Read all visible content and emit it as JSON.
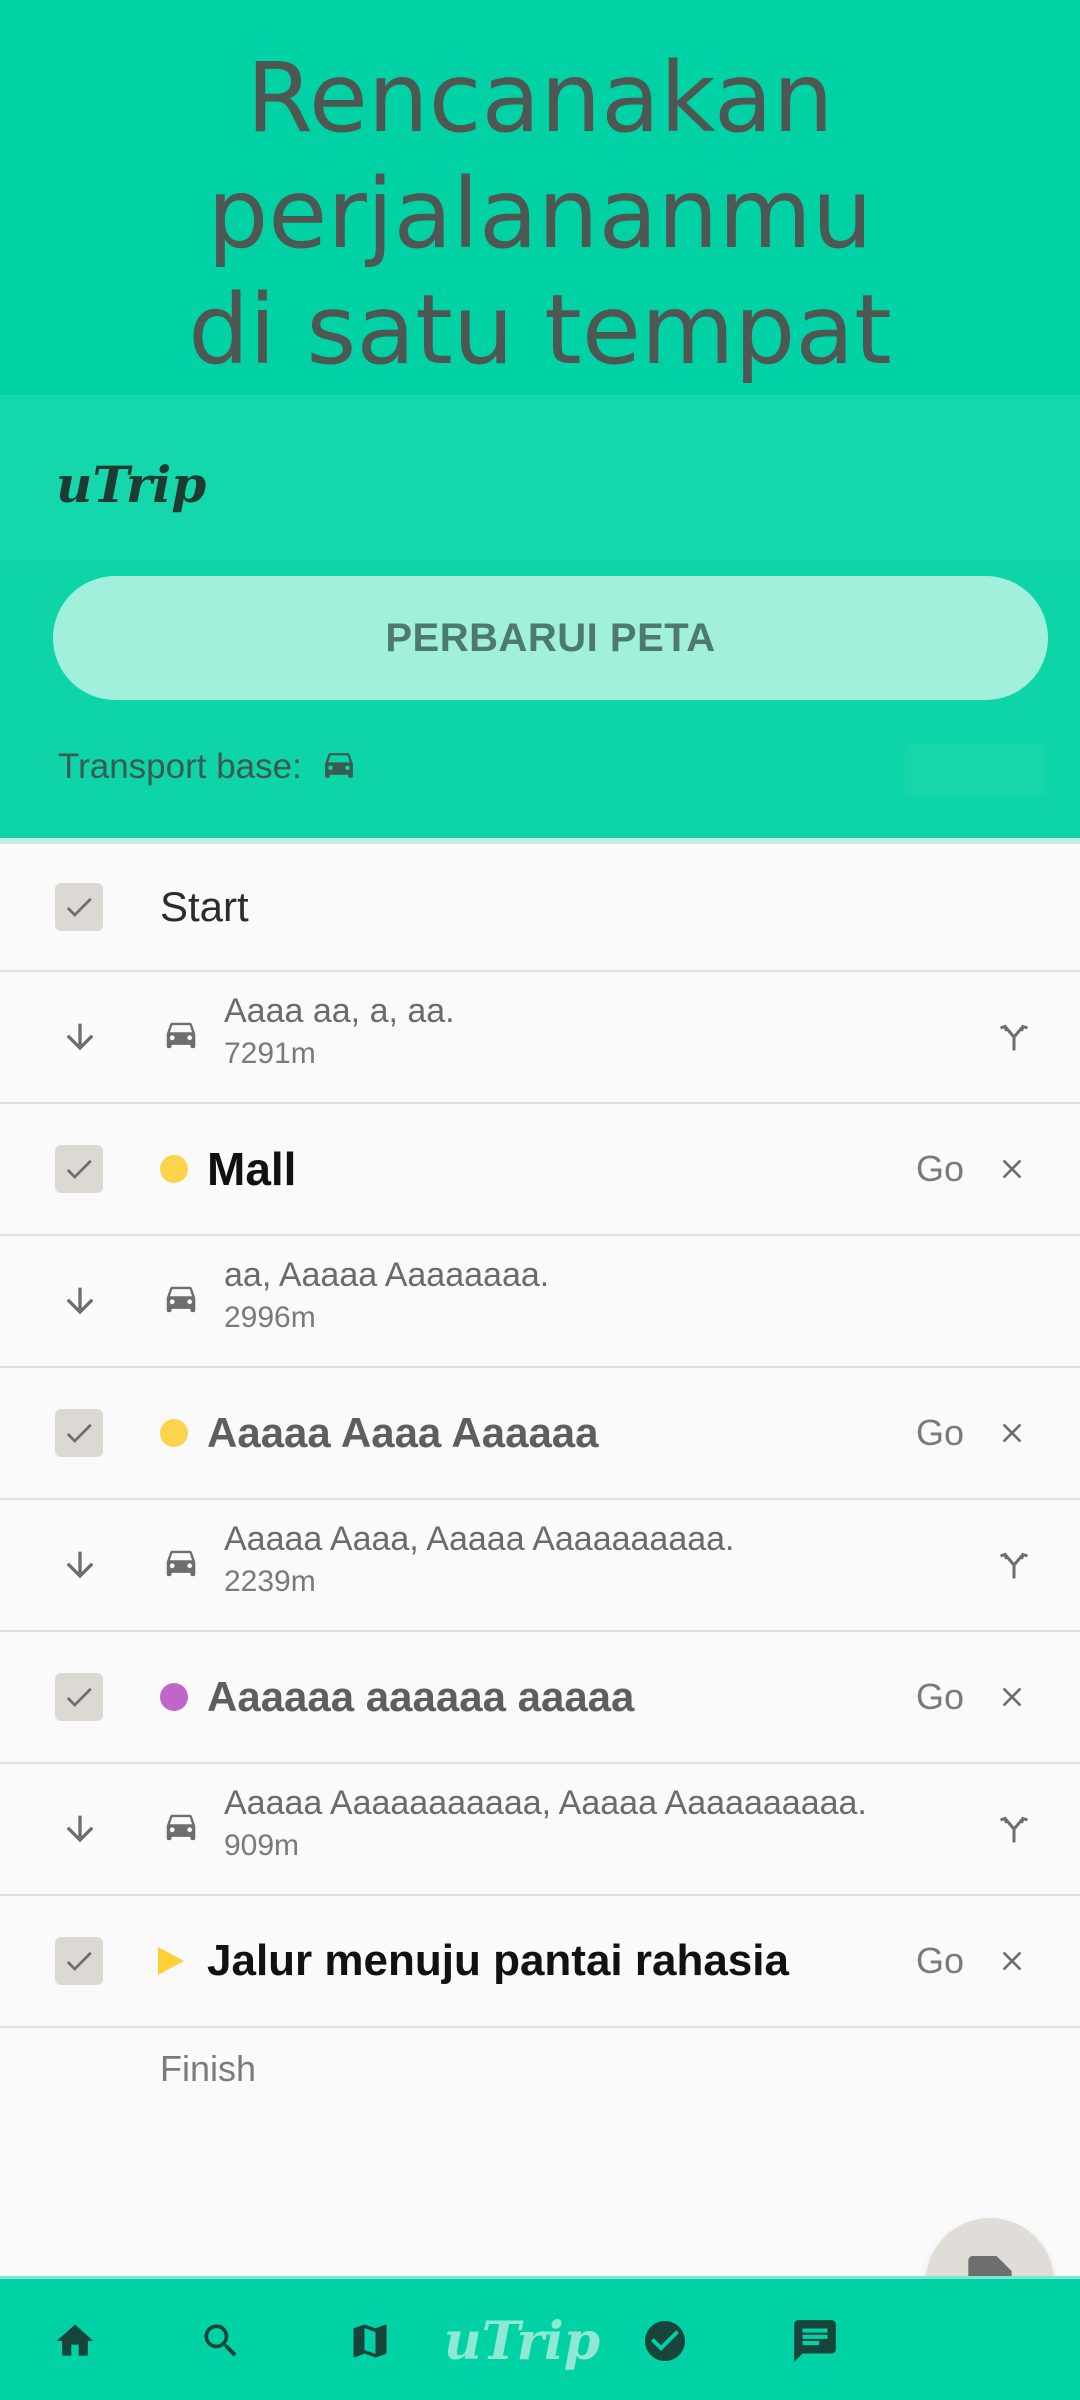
{
  "hero": {
    "lines": [
      "Rencanakan",
      "perjalananmu",
      "di satu tempat"
    ]
  },
  "brand": {
    "logo_text": "uTrip"
  },
  "panel": {
    "update_button": "PERBARUI PETA",
    "transport_label": "Transport base:"
  },
  "itinerary": {
    "start_label": "Start",
    "finish_label": "Finish",
    "go_label": "Go",
    "stops": [
      {
        "name": "Mall",
        "marker": "yellow-dot",
        "color": "#fcd34d"
      },
      {
        "name": "Aaaaa Aaaa Aaaaaa",
        "marker": "yellow-dot",
        "color": "#fcd34d"
      },
      {
        "name": "Aaaaaa aaaaaa aaaaa",
        "marker": "purple-dot",
        "color": "#c065c9"
      },
      {
        "name": "Jalur menuju pantai rahasia",
        "marker": "yellow-triangle",
        "color": "#fcd036"
      }
    ],
    "segments": [
      {
        "address": "Aaaa aa, a, aa.",
        "distance": "7291m",
        "fork_icon": true
      },
      {
        "address": "aa, Aaaaa Aaaaaaaa.",
        "distance": "2996m",
        "fork_icon": false
      },
      {
        "address": "Aaaaa Aaaa, Aaaaa Aaaaaaaaaa.",
        "distance": "2239m",
        "fork_icon": true
      },
      {
        "address": "Aaaaa Aaaaaaaaaaa, Aaaaa Aaaaaaaaaa.",
        "distance": "909m",
        "fork_icon": true
      }
    ]
  },
  "bottom_nav": {
    "items": [
      "home-icon",
      "search-icon",
      "map-icon",
      "utrip-logo",
      "check-circle-icon",
      "chat-icon"
    ],
    "logo_text": "uTrip"
  },
  "colors": {
    "primary": "#00d2a5",
    "button": "#a1f0dc",
    "text_dark": "#4f5753"
  }
}
